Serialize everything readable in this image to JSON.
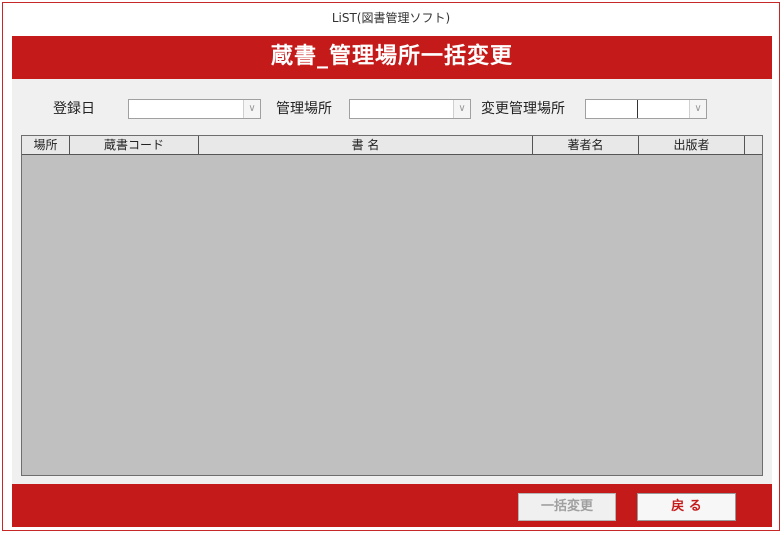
{
  "window": {
    "title": "LiST(図書管理ソフト)"
  },
  "header": {
    "title": "蔵書_管理場所一括変更"
  },
  "form": {
    "registration_date_label": "登録日",
    "location_label": "管理場所",
    "new_location_label": "変更管理場所",
    "registration_date_value": "",
    "location_value": "",
    "new_location_value": ""
  },
  "list": {
    "columns": [
      "場所",
      "蔵書コード",
      "書 名",
      "著者名",
      "出版者"
    ]
  },
  "buttons": {
    "bulk_change_label": "一括変更",
    "back_label": "戻 る"
  },
  "colors": {
    "accent": "#c41a1a",
    "back_text": "#c41a1a",
    "disabled_text": "#a0a0a0"
  }
}
